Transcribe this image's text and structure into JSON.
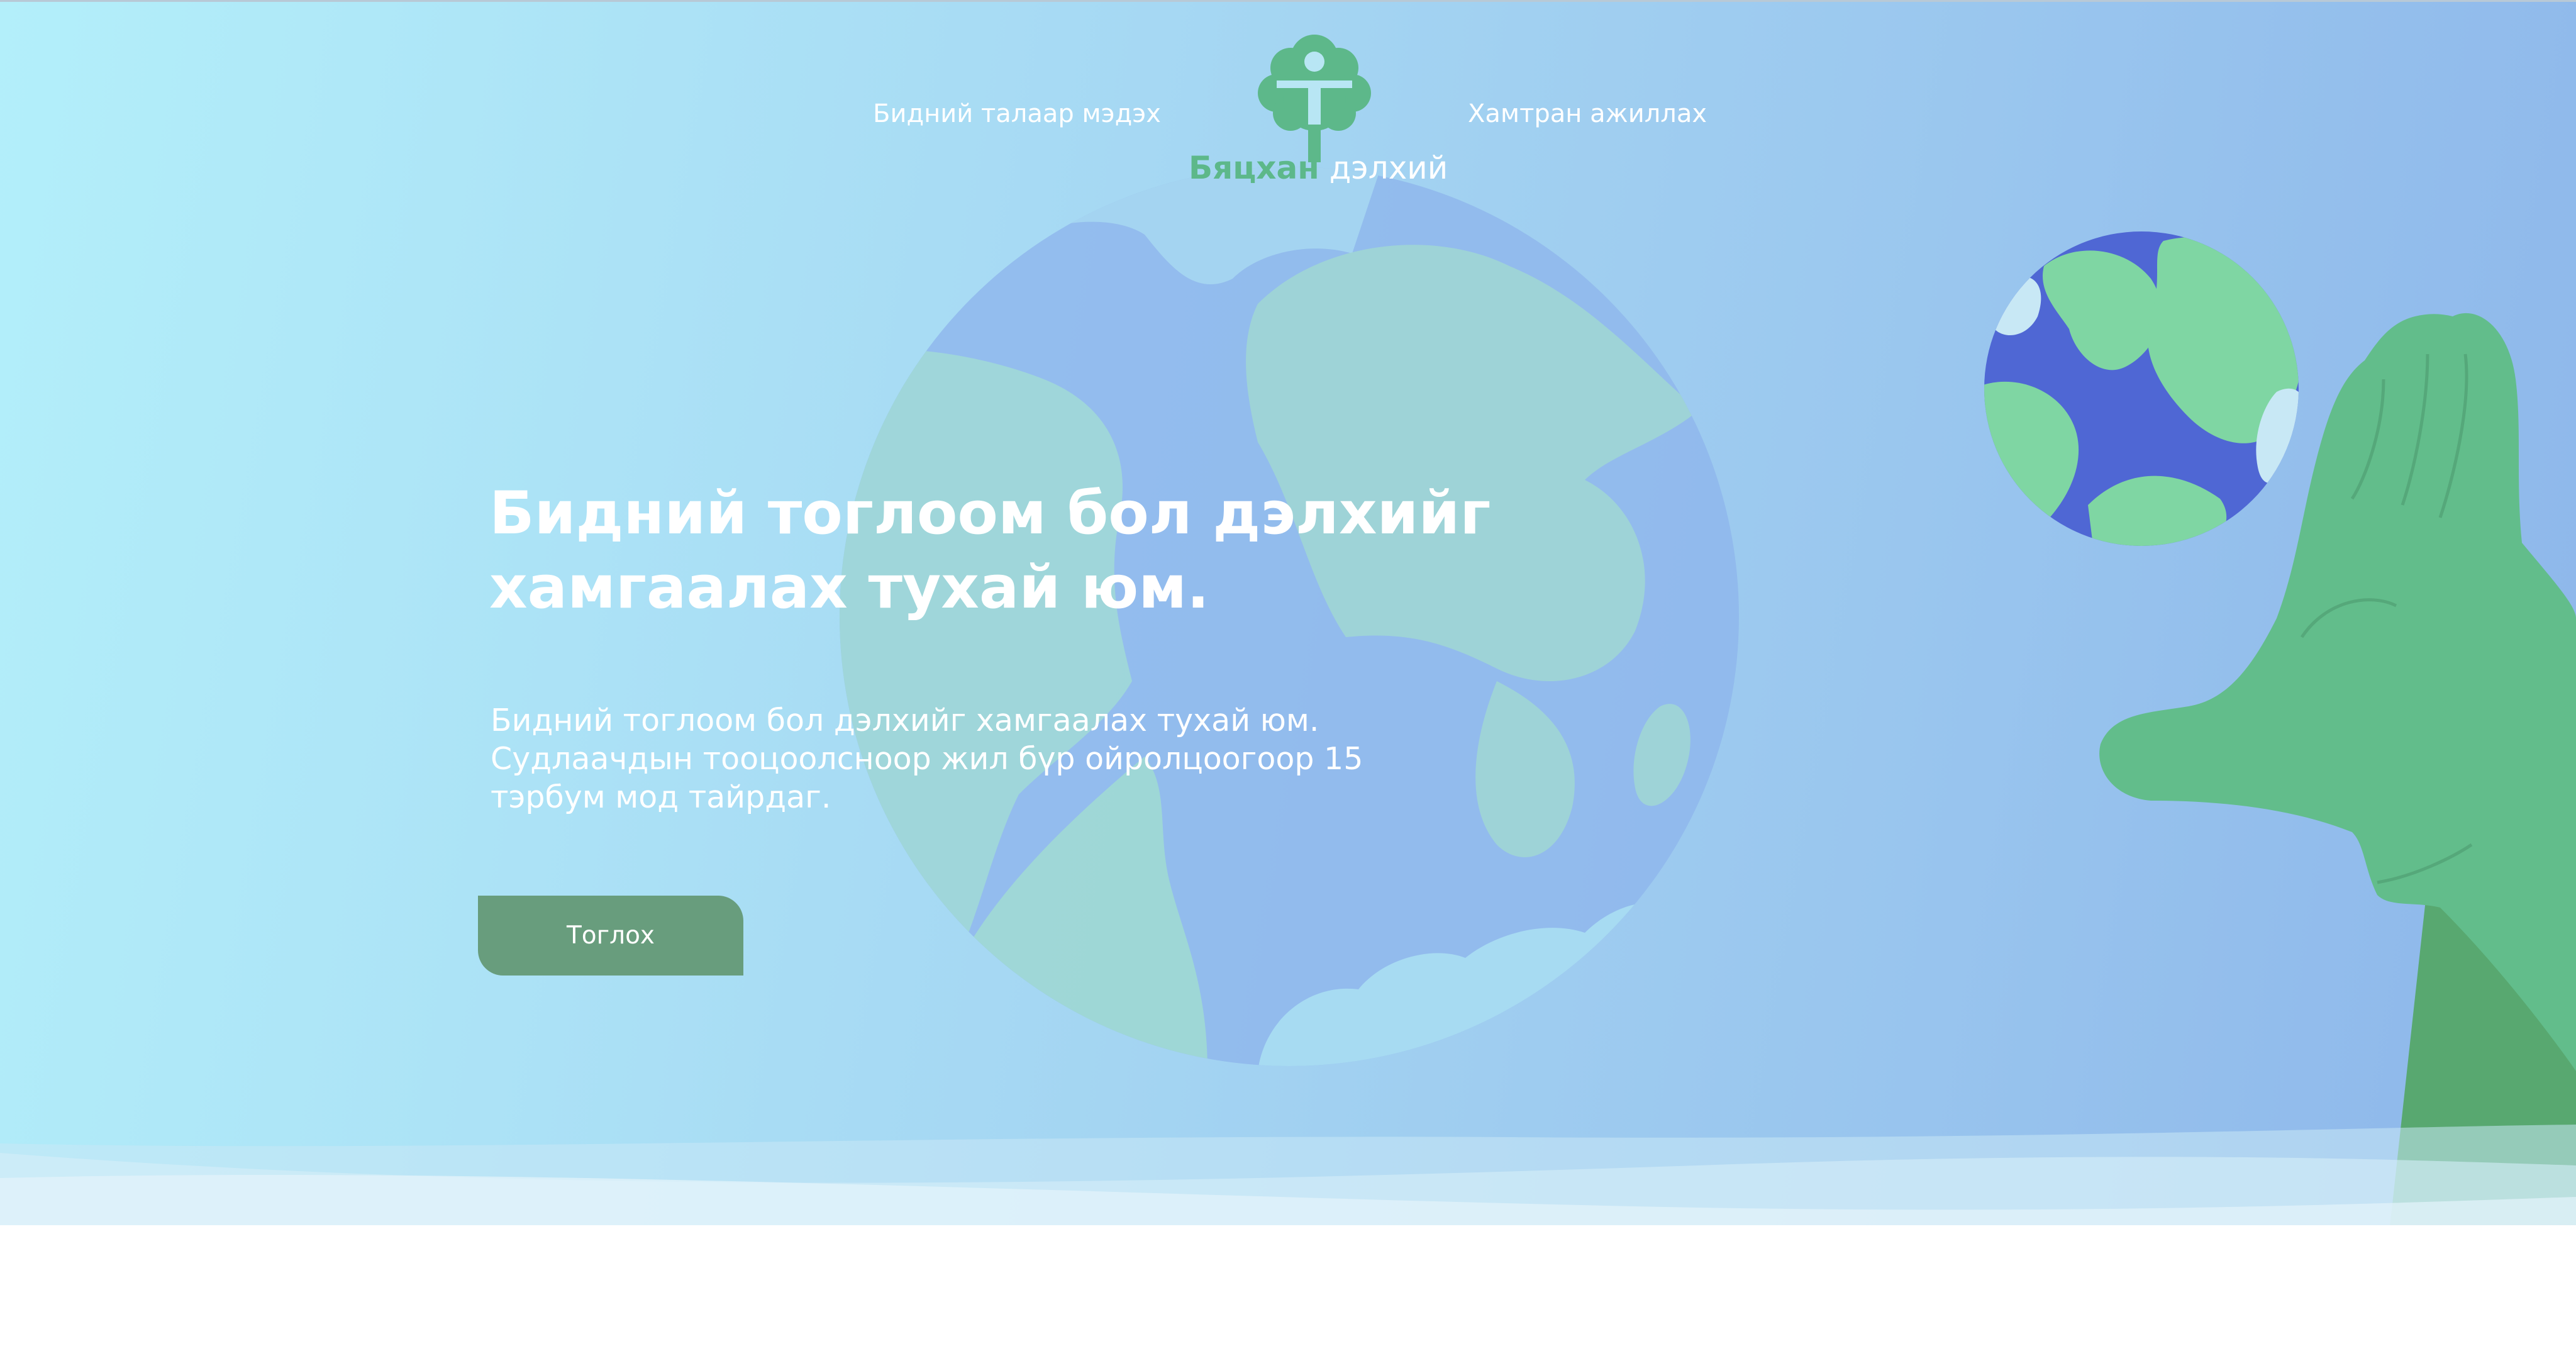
{
  "nav": {
    "about_label": "Бидний талаар мэдэх",
    "partner_label": "Хамтран ажиллах"
  },
  "logo": {
    "name_strong": "Бяцхан",
    "name_light": "дэлхий"
  },
  "hero": {
    "headline": "Бидний тоглоом бол дэлхийг хамгаалах тухай юм.",
    "description": "Бидний тоглоом бол дэлхийг хамгаалах тухай юм. Судлаачдын тооцоолсноор жил бүр ойролцоогоор 15 тэрбум мод тайрдаг.",
    "play_button_label": "Тоглох"
  },
  "colors": {
    "brand_green": "#5db88a",
    "button_green": "#689d7d",
    "gradient_left": "#b3effa",
    "gradient_right": "#8db6ea"
  },
  "icons": {
    "logo": "tree-person-logo-icon",
    "globe_background": "globe-illustration-icon",
    "small_globe": "small-globe-icon",
    "hand": "green-hand-icon"
  }
}
